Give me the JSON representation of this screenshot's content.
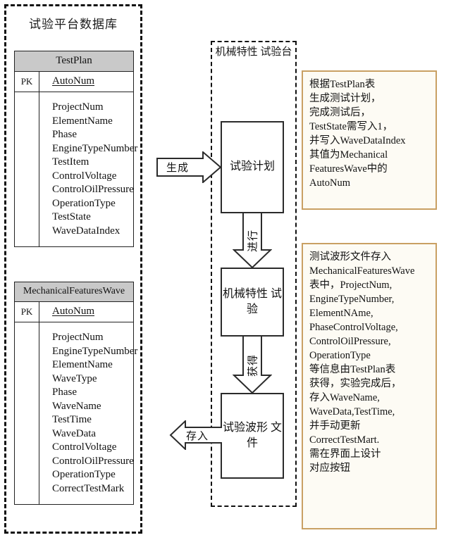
{
  "database_panel": {
    "title": "试验平台数据库",
    "tables": [
      {
        "name": "TestPlan",
        "pk_label": "PK",
        "pk_field": "AutoNum",
        "attributes": [
          "ProjectNum",
          "ElementName",
          "Phase",
          "EngineTypeNumber",
          "TestItem",
          "ControlVoltage",
          "ControlOilPressure",
          "OperationType",
          "TestState",
          "WaveDataIndex"
        ]
      },
      {
        "name": "MechanicalFeaturesWave",
        "pk_label": "PK",
        "pk_field": "AutoNum",
        "attributes": [
          "ProjectNum",
          "EngineTypeNumber",
          "ElementName",
          "WaveType",
          "Phase",
          "WaveName",
          "TestTime",
          "WaveData",
          "ControlVoltage",
          "ControlOilPressure",
          "OperationType",
          "CorrectTestMark"
        ]
      }
    ]
  },
  "bench_panel": {
    "title": "机械特性\n试验台",
    "steps": [
      {
        "label": "试验计划"
      },
      {
        "label": "机械特性\n试验"
      },
      {
        "label": "试验波形\n文件"
      }
    ]
  },
  "arrows": {
    "generate": "生成",
    "proceed": "进行",
    "obtain": "获得",
    "store": "存入"
  },
  "notes": [
    {
      "id": "note-plan",
      "text": "根据TestPlan表\n生成测试计划，\n完成测试后，\nTestState需写入1，\n并写入WaveDataIndex\n 其值为Mechanical\nFeaturesWave中的\nAutoNum"
    },
    {
      "id": "note-wave",
      "text": "测试波形文件存入\nMechanicalFeaturesWave\n表中，ProjectNum,\nEngineTypeNumber,\nElementNAme,\nPhaseControlVoltage,\nControlOilPressure,\nOperationType\n等信息由TestPlan表\n获得，实验完成后，\n存入WaveName,\nWaveData,TestTime,\n并手动更新\nCorrectTestMart.\n需在界面上设计\n对应按钮"
    }
  ],
  "colors": {
    "table_header_fill": "#c9c9c9",
    "note_border": "#c9a063",
    "note_fill": "#fdfbf4",
    "line": "#2b2b2b"
  }
}
